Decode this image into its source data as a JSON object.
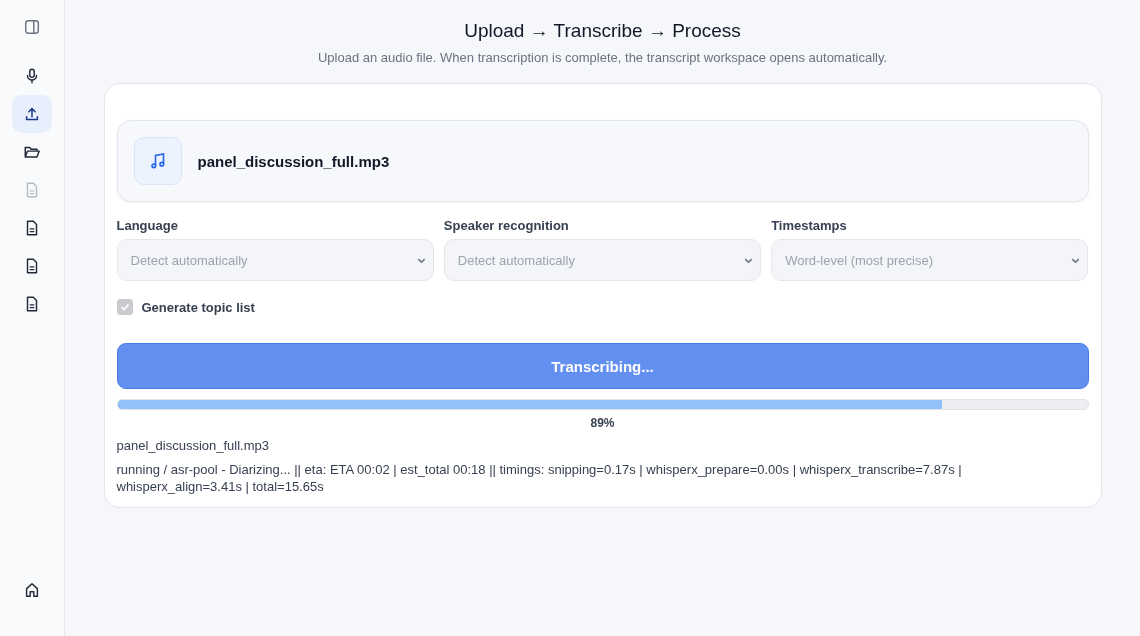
{
  "sidebar": {
    "items": [
      {
        "kind": "panel",
        "selected": false,
        "disabled": false
      },
      {
        "kind": "mic",
        "selected": false,
        "disabled": false
      },
      {
        "kind": "upload",
        "selected": true,
        "disabled": false
      },
      {
        "kind": "folder",
        "selected": false,
        "disabled": false
      },
      {
        "kind": "document",
        "selected": false,
        "disabled": true
      },
      {
        "kind": "document",
        "selected": false,
        "disabled": false
      },
      {
        "kind": "document",
        "selected": false,
        "disabled": false
      },
      {
        "kind": "document",
        "selected": false,
        "disabled": false
      }
    ],
    "bottom_items": [
      {
        "kind": "home",
        "selected": false,
        "disabled": false
      }
    ]
  },
  "header": {
    "title": "Upload → Transcribe → Process",
    "subtitle": "Upload an audio file. When transcription is complete, the transcript workspace opens automatically."
  },
  "file": {
    "name": "panel_discussion_full.mp3"
  },
  "options": [
    {
      "label": "Language",
      "value": "Detect automatically"
    },
    {
      "label": "Speaker recognition",
      "value": "Detect automatically"
    },
    {
      "label": "Timestamps",
      "value": "Word-level (most precise)"
    }
  ],
  "topic_list": {
    "label": "Generate topic list",
    "checked": true,
    "disabled": true
  },
  "action_button": {
    "label": "Transcribing..."
  },
  "progress": {
    "level": 0.85,
    "percent": "89%",
    "file": "panel_discussion_full.mp3",
    "status": "running / asr-pool - Diarizing... || eta: ETA 00:02 | est_total 00:18 || timings: snipping=0.17s | whisperx_prepare=0.00s | whisperx_transcribe=7.87s | whisperx_align=3.41s | total=15.65s"
  }
}
